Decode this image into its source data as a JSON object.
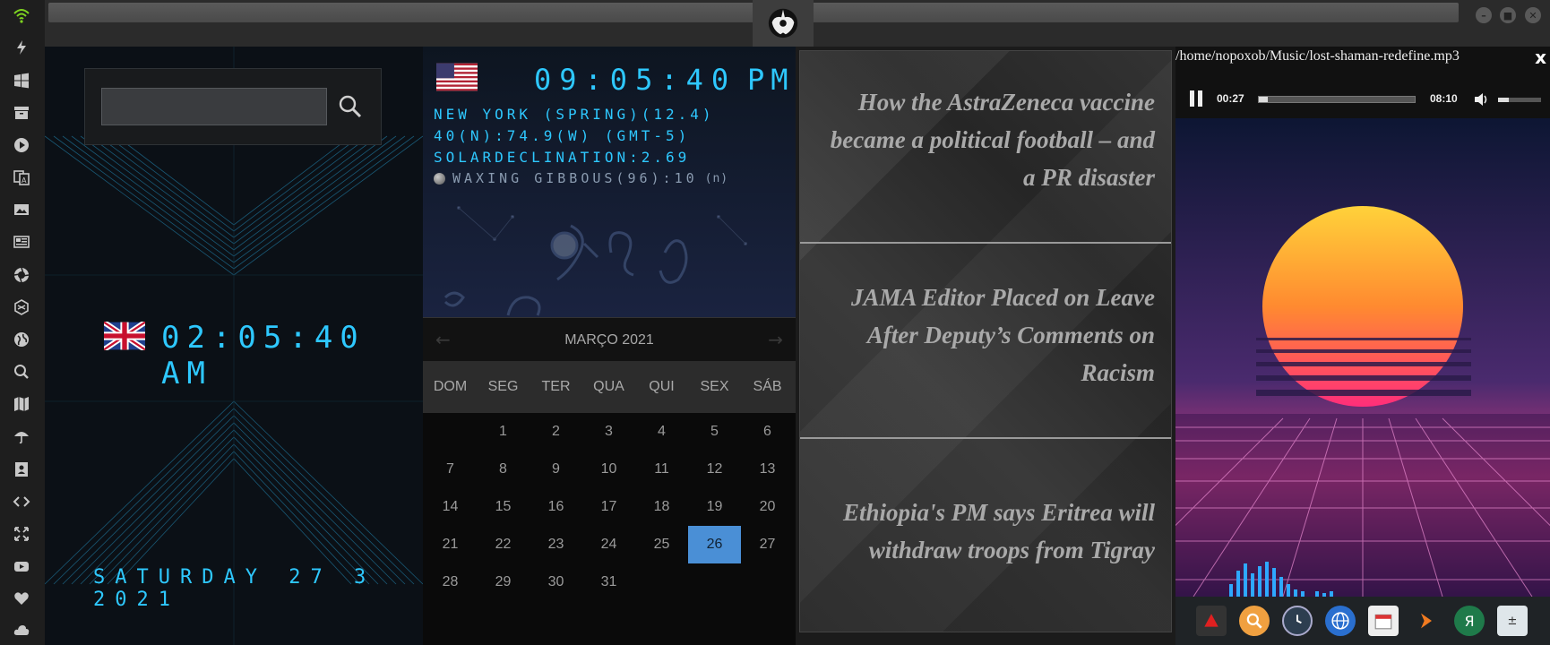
{
  "dock": {
    "icons": [
      "wifi-icon",
      "power-icon",
      "windows-icon",
      "archive-icon",
      "play-icon",
      "translate-icon",
      "image-icon",
      "news-icon",
      "aperture-icon",
      "hexagon-icon",
      "globe-icon",
      "search-icon",
      "map-icon",
      "umbrella-icon",
      "contacts-icon",
      "code-icon",
      "expand-icon",
      "youtube-icon",
      "heart-icon",
      "cloud-icon"
    ],
    "accent": "#7ed321"
  },
  "topbar": {
    "window_buttons": [
      "minimize-icon",
      "maximize-icon",
      "close-icon"
    ]
  },
  "search": {
    "placeholder": "",
    "value": ""
  },
  "uk_clock": {
    "flag": "uk-flag",
    "time": "02:05:40 AM",
    "date": "SATURDAY 27 3 2021",
    "color": "#2ec8ff"
  },
  "us_clock": {
    "flag": "us-flag",
    "time": "09:05:40",
    "ampm": "PM",
    "location": "NEW YORK (SPRING)(12.4)",
    "coords": "40(N):74.9(W) (GMT-5)",
    "declination": "SOLARDECLINATION:2.69",
    "moon": "WAXING GIBBOUS(96):10",
    "moon_hemisphere": "(n)"
  },
  "calendar": {
    "month_label": "MARÇO 2021",
    "day_names": [
      "DOM",
      "SEG",
      "TER",
      "QUA",
      "QUI",
      "SEX",
      "SÁB"
    ],
    "leading_blanks": 1,
    "days": [
      "1",
      "2",
      "3",
      "4",
      "5",
      "6",
      "7",
      "8",
      "9",
      "10",
      "11",
      "12",
      "13",
      "14",
      "15",
      "16",
      "17",
      "18",
      "19",
      "20",
      "21",
      "22",
      "23",
      "24",
      "25",
      "26",
      "27",
      "28",
      "29",
      "30",
      "31"
    ],
    "today": "26",
    "today_color": "#4a8fd6"
  },
  "news": {
    "items": [
      "How the AstraZeneca vaccine became a political football – and a PR disaster",
      "JAMA Editor Placed on Leave After Deputy’s Comments on Racism",
      "Ethiopia's PM says Eritrea will withdraw troops from Tigray"
    ]
  },
  "player": {
    "path": "/home/nopoxob/Music/lost-shaman-redefine.mp3",
    "close_label": "x",
    "current_time": "00:27",
    "duration": "08:10",
    "progress": 0.055,
    "volume": 0.25,
    "state": "playing"
  },
  "taskbar": {
    "icons": [
      "acrobat-icon",
      "search-icon",
      "clock-icon",
      "globe-icon",
      "calendar-icon",
      "arrow-icon",
      "yandex-icon",
      "calculator-icon"
    ]
  }
}
